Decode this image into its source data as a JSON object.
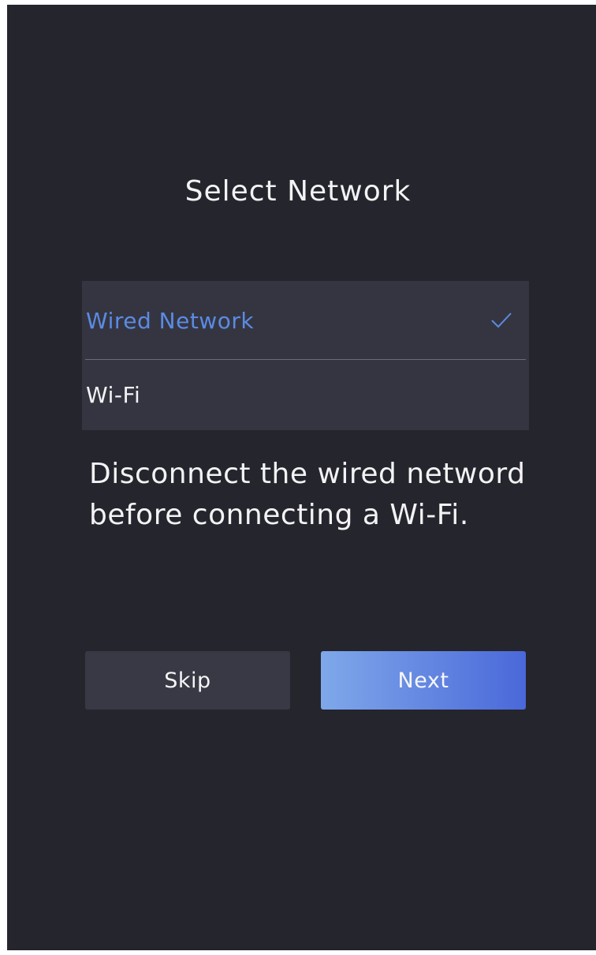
{
  "header": {
    "title": "Select Network"
  },
  "network_options": [
    {
      "label": "Wired Network",
      "selected": true
    },
    {
      "label": "Wi-Fi",
      "selected": false
    }
  ],
  "hint": {
    "text": "Disconnect the wired netword before connecting a Wi-Fi."
  },
  "actions": {
    "skip_label": "Skip",
    "next_label": "Next"
  },
  "colors": {
    "background": "#25252d",
    "list_background": "#353541",
    "selected_text": "#5b8be3",
    "primary_gradient_start": "#7fa8ea",
    "primary_gradient_end": "#4a68d9",
    "secondary_button": "#393945"
  },
  "icons": {
    "selected_indicator": "check-icon"
  }
}
